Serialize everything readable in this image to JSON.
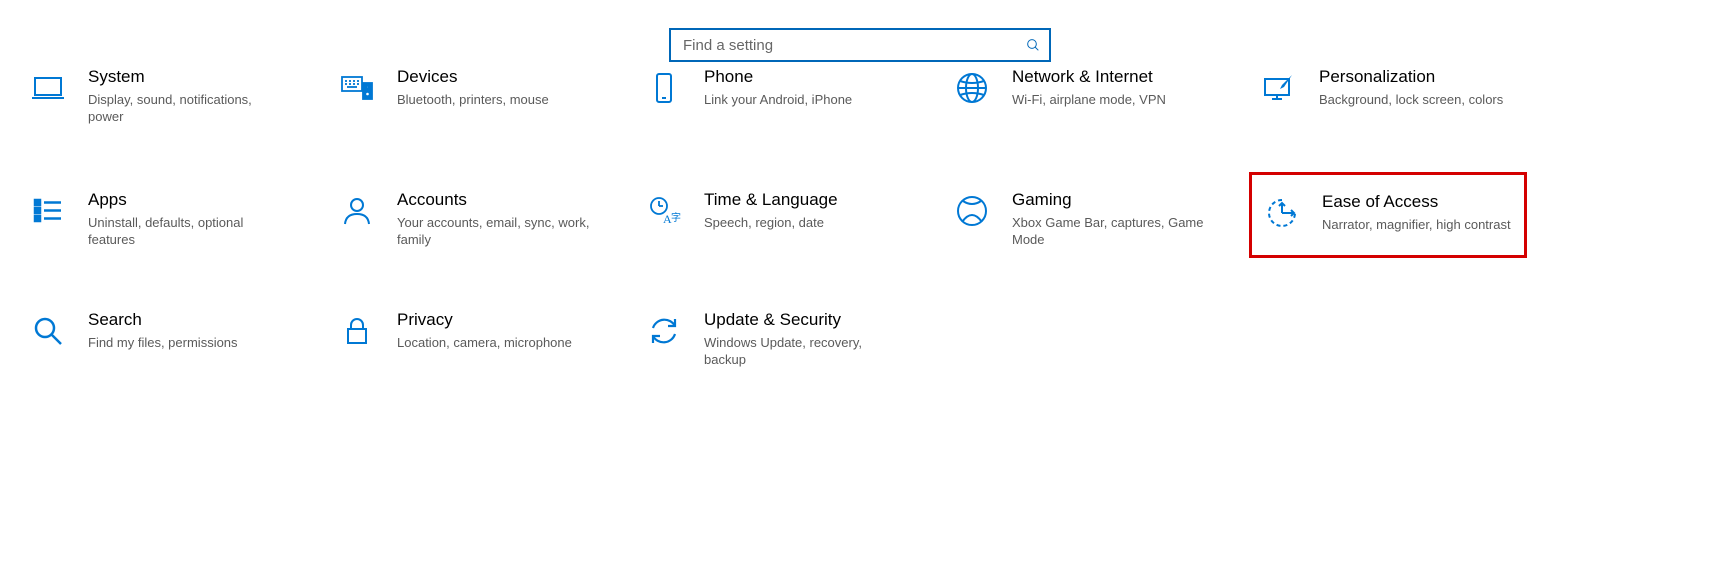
{
  "search": {
    "placeholder": "Find a setting"
  },
  "columns": [
    24,
    333,
    640,
    948,
    1255
  ],
  "rows": [
    135,
    258,
    378
  ],
  "tiles": {
    "system": {
      "title": "System",
      "desc": "Display, sound, notifications, power"
    },
    "devices": {
      "title": "Devices",
      "desc": "Bluetooth, printers, mouse"
    },
    "phone": {
      "title": "Phone",
      "desc": "Link your Android, iPhone"
    },
    "network": {
      "title": "Network & Internet",
      "desc": "Wi-Fi, airplane mode, VPN"
    },
    "personalize": {
      "title": "Personalization",
      "desc": "Background, lock screen, colors"
    },
    "apps": {
      "title": "Apps",
      "desc": "Uninstall, defaults, optional features"
    },
    "accounts": {
      "title": "Accounts",
      "desc": "Your accounts, email, sync, work, family"
    },
    "time": {
      "title": "Time & Language",
      "desc": "Speech, region, date"
    },
    "gaming": {
      "title": "Gaming",
      "desc": "Xbox Game Bar, captures, Game Mode"
    },
    "ease": {
      "title": "Ease of Access",
      "desc": "Narrator, magnifier, high contrast"
    },
    "search_cat": {
      "title": "Search",
      "desc": "Find my files, permissions"
    },
    "privacy": {
      "title": "Privacy",
      "desc": "Location, camera, microphone"
    },
    "update": {
      "title": "Update & Security",
      "desc": "Windows Update, recovery, backup"
    }
  }
}
